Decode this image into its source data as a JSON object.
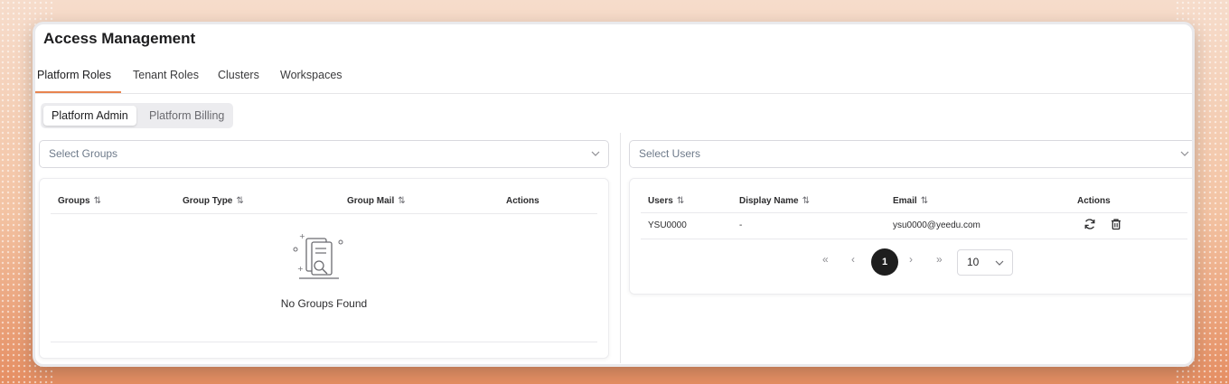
{
  "header": {
    "title": "Access Management"
  },
  "tabs": [
    {
      "label": "Platform Roles",
      "active": true
    },
    {
      "label": "Tenant Roles"
    },
    {
      "label": "Clusters"
    },
    {
      "label": "Workspaces"
    }
  ],
  "subtabs": [
    {
      "label": "Platform Admin",
      "active": true
    },
    {
      "label": "Platform Billing"
    }
  ],
  "groups": {
    "select_placeholder": "Select Groups",
    "columns": [
      "Groups",
      "Group Type",
      "Group Mail",
      "Actions"
    ],
    "empty_text": "No Groups Found",
    "empty_icon": "document-search-icon"
  },
  "users": {
    "select_placeholder": "Select Users",
    "columns": [
      "Users",
      "Display Name",
      "Email",
      "Actions"
    ],
    "rows": [
      {
        "user": "YSU0000",
        "display_name": "-",
        "email": "ysu0000@yeedu.com"
      }
    ],
    "row_actions": [
      "refresh-icon",
      "trash-icon"
    ],
    "pagination": {
      "first": "«",
      "prev": "‹",
      "current_page": "1",
      "next": "›",
      "last": "»",
      "page_size": "10"
    }
  },
  "colors": {
    "accent": "#e8844f",
    "active_page": "#1e1e1e"
  }
}
